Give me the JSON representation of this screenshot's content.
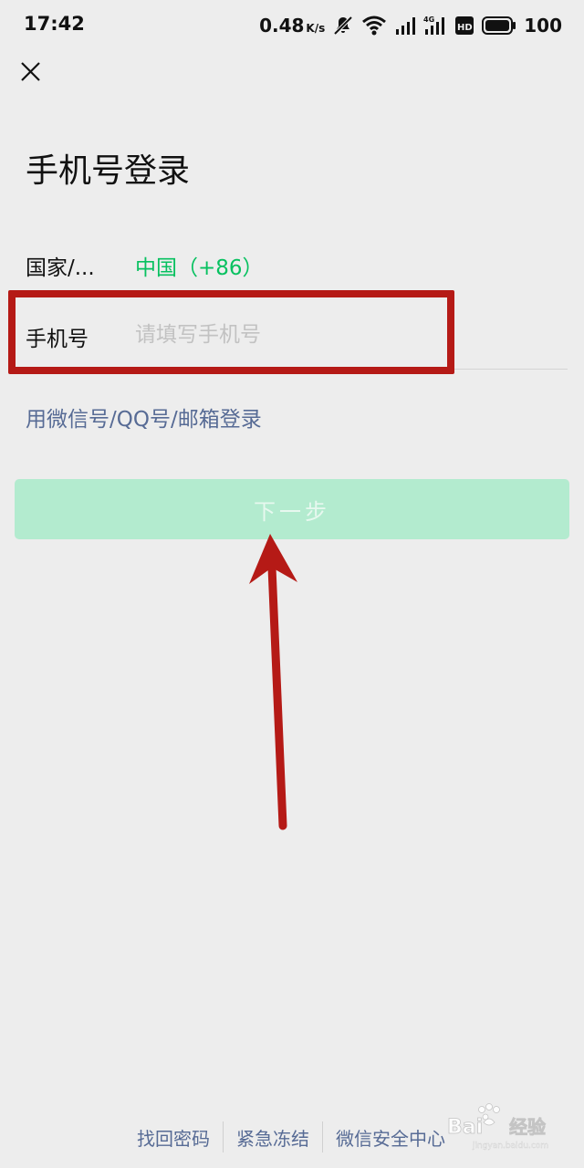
{
  "status_bar": {
    "time": "17:42",
    "net_speed": "0.48",
    "net_unit": "K/s",
    "battery": "100",
    "icons": [
      "mute-bell-icon",
      "wifi-icon",
      "signal-icon",
      "signal-4g-icon",
      "hd-icon",
      "battery-icon"
    ]
  },
  "header": {
    "close_icon": "close-icon",
    "title": "手机号登录"
  },
  "form": {
    "country_label": "国家/...",
    "country_value": "中国（+86）",
    "phone_label": "手机号",
    "phone_value": "",
    "phone_placeholder": "请填写手机号"
  },
  "alt_login": "用微信号/QQ号/邮箱登录",
  "next_button": "下一步",
  "footer": {
    "links": [
      "找回密码",
      "紧急冻结",
      "微信安全中心"
    ]
  },
  "watermark": {
    "text": "Baidu 经验",
    "subtext": "jingyan.baidu.com"
  },
  "colors": {
    "background": "#ededed",
    "accent_green": "#07c160",
    "link_blue": "#576b95",
    "button_disabled_bg": "#b3ebcf",
    "annotation_red": "#b51a16"
  }
}
